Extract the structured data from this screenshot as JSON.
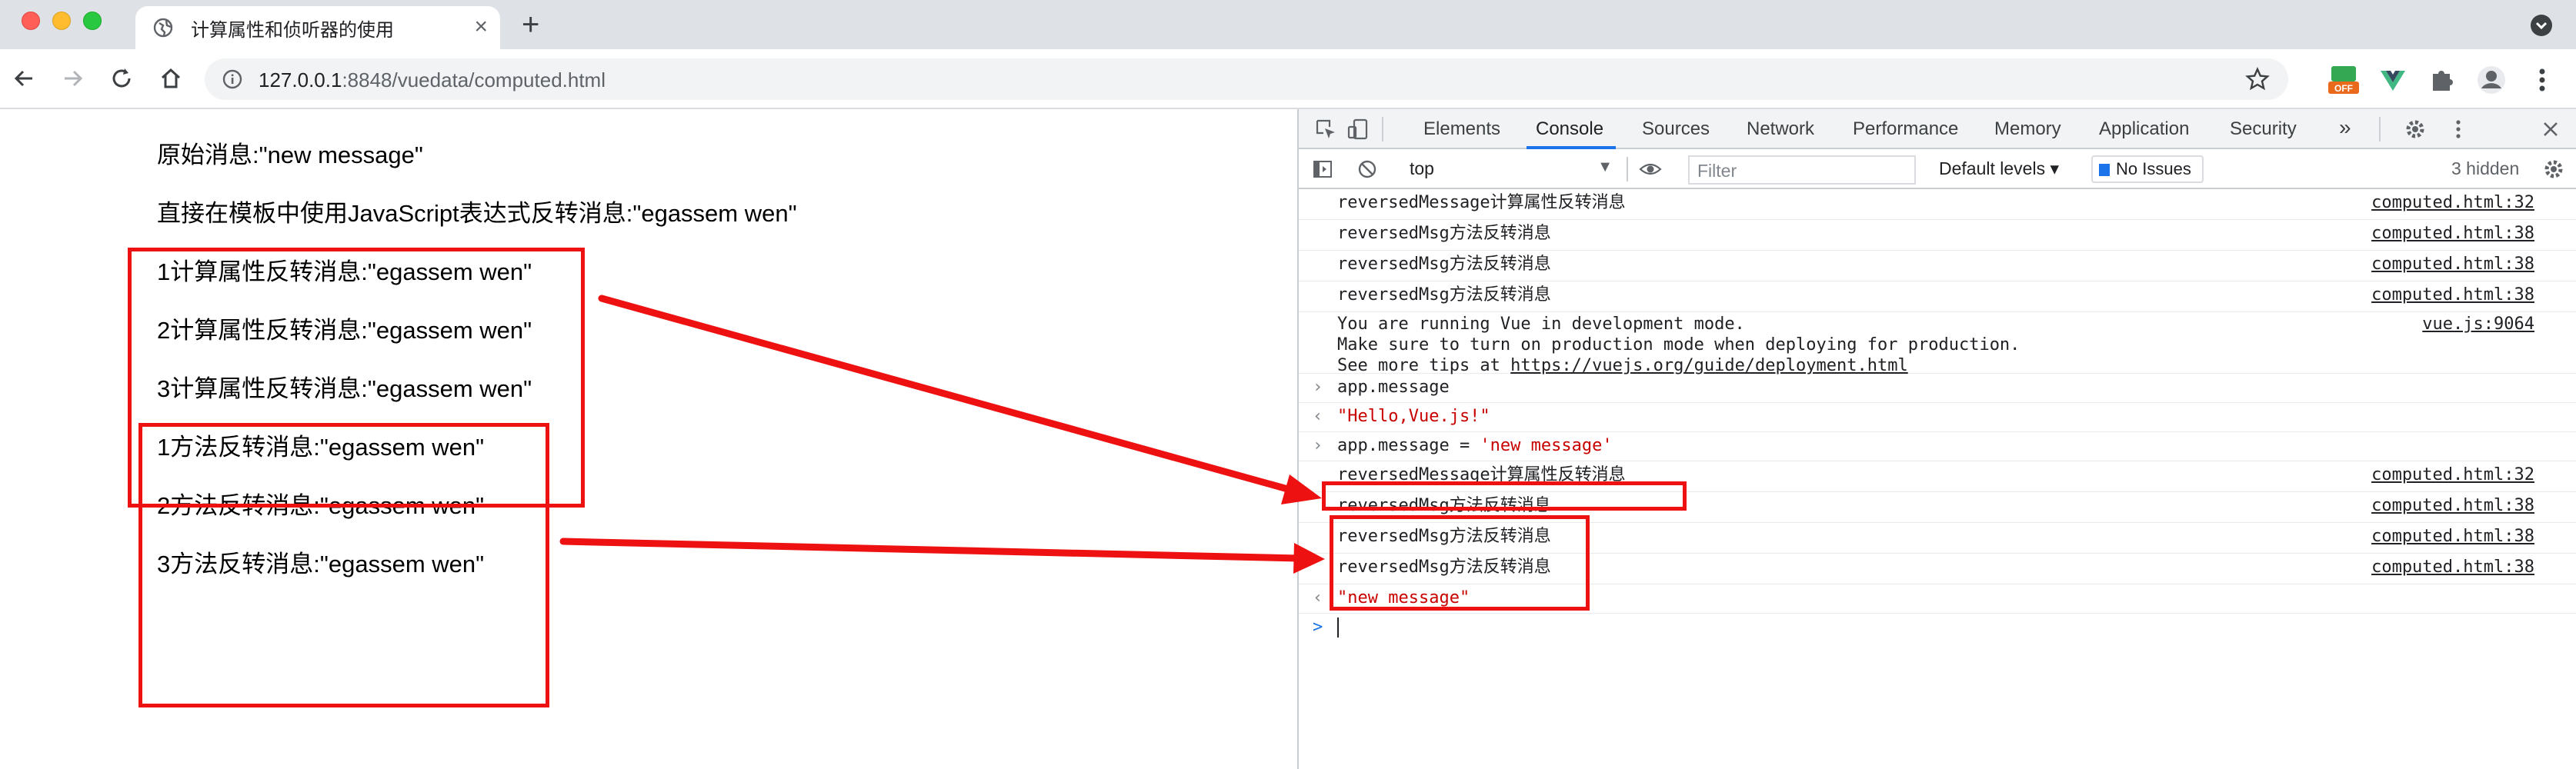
{
  "browser": {
    "tab_title": "计算属性和侦听器的使用",
    "tab_close": "×",
    "new_tab": "+",
    "url_host": "127.0.0.1",
    "url_rest": ":8848/vuedata/computed.html",
    "ext_badge": "OFF"
  },
  "page": {
    "lines": [
      "原始消息:\"new message\"",
      "直接在模板中使用JavaScript表达式反转消息:\"egassem wen\"",
      "1计算属性反转消息:\"egassem wen\"",
      "2计算属性反转消息:\"egassem wen\"",
      "3计算属性反转消息:\"egassem wen\"",
      "1方法反转消息:\"egassem wen\"",
      "2方法反转消息:\"egassem wen\"",
      "3方法反转消息:\"egassem wen\""
    ]
  },
  "devtools": {
    "tabs": [
      "Elements",
      "Console",
      "Sources",
      "Network",
      "Performance",
      "Memory",
      "Application",
      "Security"
    ],
    "more_tabs": "»",
    "active_tab": "Console",
    "context": "top",
    "filter_placeholder": "Filter",
    "levels": "Default levels ▾",
    "issues": "No Issues",
    "hidden": "3 hidden"
  },
  "console": {
    "rows": [
      {
        "msg": "reversedMessage计算属性反转消息",
        "src": "computed.html:32"
      },
      {
        "msg": "reversedMsg方法反转消息",
        "src": "computed.html:38"
      },
      {
        "msg": "reversedMsg方法反转消息",
        "src": "computed.html:38"
      },
      {
        "msg": "reversedMsg方法反转消息",
        "src": "computed.html:38"
      }
    ],
    "vue_line1": "You are running Vue in development mode.",
    "vue_line2": "Make sure to turn on production mode when deploying for production.",
    "vue_line3_prefix": "See more tips at ",
    "vue_link": "https://vuejs.org/guide/deployment.html",
    "vue_src": "vue.js:9064",
    "input1": "app.message",
    "output1": "\"Hello,Vue.js!\"",
    "input2_prefix": "app.message = ",
    "input2_str": "'new message'",
    "rows2": [
      {
        "msg": "reversedMessage计算属性反转消息",
        "src": "computed.html:32"
      },
      {
        "msg": "reversedMsg方法反转消息",
        "src": "computed.html:38"
      },
      {
        "msg": "reversedMsg方法反转消息",
        "src": "computed.html:38"
      },
      {
        "msg": "reversedMsg方法反转消息",
        "src": "computed.html:38"
      }
    ],
    "output2": "\"new message\"",
    "prompt": ">"
  },
  "colors": {
    "annotation_red": "#ee1111",
    "console_string": "#c80000",
    "active_tab_underline": "#1a73e8"
  }
}
